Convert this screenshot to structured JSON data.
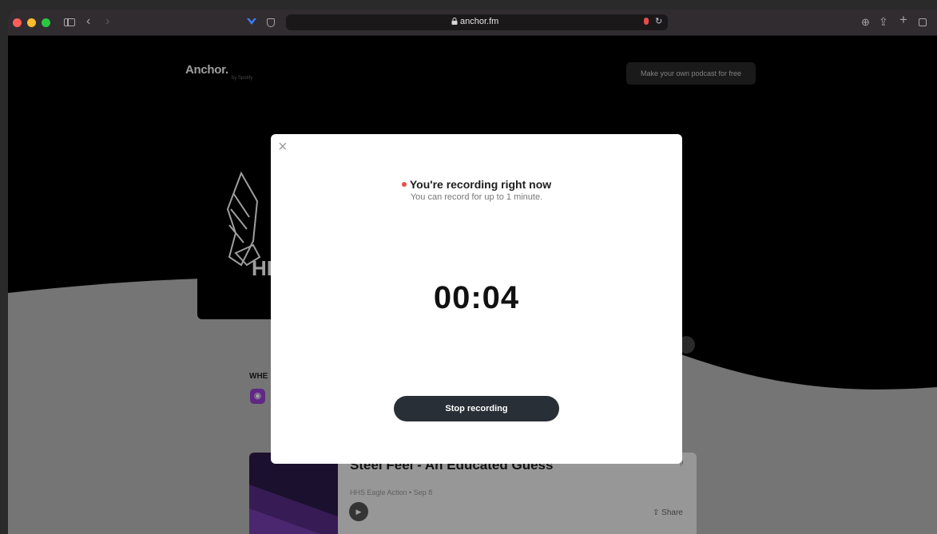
{
  "browser": {
    "url": "anchor.fm",
    "icons": [
      "sidebar-icon",
      "back-icon",
      "forward-icon",
      "extension-icon",
      "shield-icon",
      "lock-icon",
      "mic-icon",
      "reload-icon",
      "download-icon",
      "share-icon",
      "new-tab-icon",
      "tabs-overview-icon"
    ],
    "back_glyph": "‹",
    "forward_glyph": "›",
    "plus_glyph": "+"
  },
  "page": {
    "logo": "Anchor.",
    "logo_sub": "by Spotify",
    "cta": "Make your own podcast for free",
    "cover_text": "HI",
    "where_label": "WHE",
    "episode": {
      "title": "Steel Feel - An Educated Guess",
      "meta": "HHS Eagle Action • Sep 8",
      "share": "Share"
    }
  },
  "modal": {
    "title": "You're recording right now",
    "subtitle": "You can record for up to 1 minute.",
    "timer": "00:04",
    "stop_button": "Stop recording",
    "close_glyph": "×"
  },
  "colors": {
    "recording_dot": "#ef4b4b",
    "stop_button_bg": "#292f36",
    "podcast_icon": "#9b3fd6"
  }
}
